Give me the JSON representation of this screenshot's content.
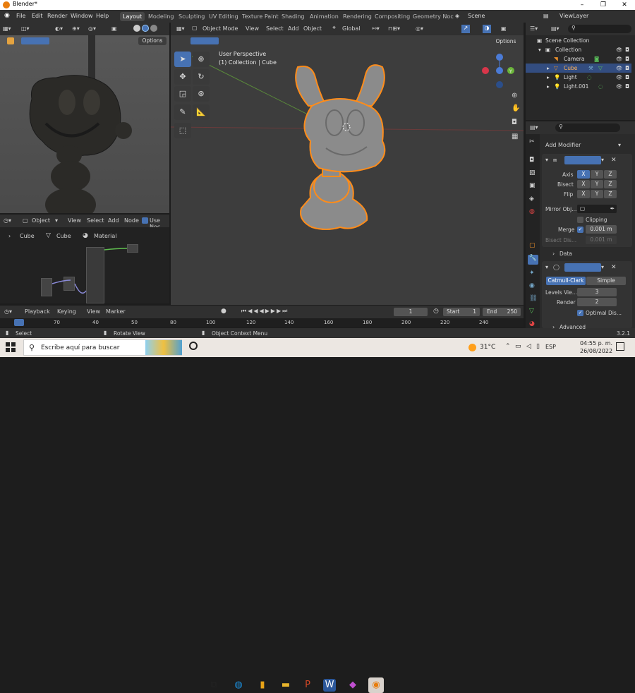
{
  "window": {
    "title": "Blender*",
    "minimize": "–",
    "maximize": "❐",
    "close": "✕"
  },
  "menu": {
    "file": "File",
    "edit": "Edit",
    "render": "Render",
    "window": "Window",
    "help": "Help"
  },
  "workspaces": [
    "Layout",
    "Modeling",
    "Sculpting",
    "UV Editing",
    "Texture Paint",
    "Shading",
    "Animation",
    "Rendering",
    "Compositing",
    "Geometry Noc"
  ],
  "scene": "Scene",
  "view_layer": "ViewLayer",
  "left_viewport": {
    "options": "Options"
  },
  "main_viewport": {
    "mode": "Object Mode",
    "menus": [
      "View",
      "Select",
      "Add",
      "Object"
    ],
    "transform": "Global",
    "options": "Options",
    "info_line1": "User Perspective",
    "info_line2": "(1) Collection | Cube",
    "gizmo_z": "Z",
    "gizmo_y": "Y"
  },
  "node_editor": {
    "type": "Object",
    "menus": [
      "View",
      "Select",
      "Add",
      "Node"
    ],
    "use_nodes": "Use Noc",
    "breadcrumb": [
      "Cube",
      "Cube",
      "Material"
    ]
  },
  "timeline": {
    "menus": [
      "Playback",
      "Keying",
      "View",
      "Marker"
    ],
    "current_frame": "1",
    "start_label": "Start",
    "start": "1",
    "end_label": "End",
    "end": "250",
    "ruler": [
      "70",
      "40",
      "50",
      "80",
      "100",
      "120",
      "140",
      "160",
      "180",
      "200",
      "220",
      "240"
    ]
  },
  "statusbar": {
    "select": "Select",
    "rotate": "Rotate View",
    "context": "Object Context Menu",
    "version": "3.2.1"
  },
  "outliner": {
    "root": "Scene Collection",
    "items": [
      {
        "name": "Collection",
        "icon": "collection-icon"
      },
      {
        "name": "Camera",
        "icon": "camera-icon"
      },
      {
        "name": "Cube",
        "icon": "mesh-icon"
      },
      {
        "name": "Light",
        "icon": "light-icon"
      },
      {
        "name": "Light.001",
        "icon": "light-icon"
      }
    ]
  },
  "properties": {
    "add_modifier": "Add Modifier",
    "mirror": {
      "axis_label": "Axis",
      "bisect_label": "Bisect",
      "flip_label": "Flip",
      "x": "X",
      "y": "Y",
      "z": "Z",
      "mirror_obj_label": "Mirror Obj...",
      "clipping": "Clipping",
      "merge_label": "Merge",
      "merge_value": "0.001 m",
      "bisect_dist_label": "Bisect Dis...",
      "bisect_dist_value": "0.001 m",
      "data_label": "Data"
    },
    "subsurf": {
      "catmull": "Catmull-Clark",
      "simple": "Simple",
      "levels_label": "Levels Vie...",
      "levels": "3",
      "render_label": "Render",
      "render": "2",
      "optimal": "Optimal Dis...",
      "advanced": "Advanced"
    }
  },
  "taskbar": {
    "search": "Escribe aquí para buscar",
    "temp": "31°C",
    "lang": "ESP",
    "time": "04:55 p. m.",
    "date": "26/08/2022"
  },
  "colors": {
    "accent": "#4772b3",
    "selection": "#ff8c1a",
    "bg": "#3d3d3d"
  }
}
